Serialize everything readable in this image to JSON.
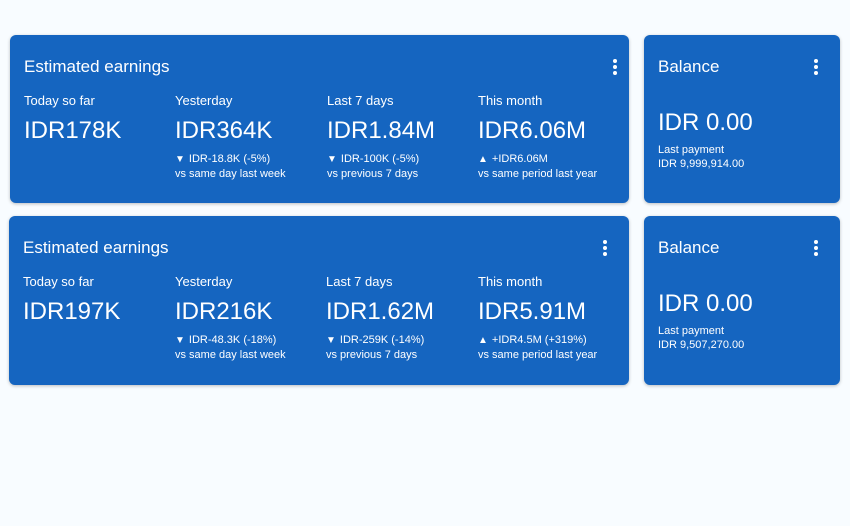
{
  "earnings_cards": [
    {
      "title": "Estimated earnings",
      "metrics": [
        {
          "label": "Today so far",
          "value": "IDR178K",
          "change": "",
          "compare": ""
        },
        {
          "label": "Yesterday",
          "value": "IDR364K",
          "arrow": "▼",
          "change": "IDR-18.8K (-5%)",
          "compare": "vs same day last week"
        },
        {
          "label": "Last 7 days",
          "value": "IDR1.84M",
          "arrow": "▼",
          "change": "IDR-100K (-5%)",
          "compare": "vs previous 7 days"
        },
        {
          "label": "This month",
          "value": "IDR6.06M",
          "arrow": "▲",
          "change": "+IDR6.06M",
          "compare": "vs same period last year"
        }
      ]
    },
    {
      "title": "Estimated earnings",
      "metrics": [
        {
          "label": "Today so far",
          "value": "IDR197K",
          "change": "",
          "compare": ""
        },
        {
          "label": "Yesterday",
          "value": "IDR216K",
          "arrow": "▼",
          "change": "IDR-48.3K (-18%)",
          "compare": "vs same day last week"
        },
        {
          "label": "Last 7 days",
          "value": "IDR1.62M",
          "arrow": "▼",
          "change": "IDR-259K (-14%)",
          "compare": "vs previous 7 days"
        },
        {
          "label": "This month",
          "value": "IDR5.91M",
          "arrow": "▲",
          "change": "+IDR4.5M (+319%)",
          "compare": "vs same period last year"
        }
      ]
    }
  ],
  "balance_cards": [
    {
      "title": "Balance",
      "value": "IDR 0.00",
      "last_payment_label": "Last payment",
      "last_payment_value": "IDR 9,999,914.00"
    },
    {
      "title": "Balance",
      "value": "IDR 0.00",
      "last_payment_label": "Last payment",
      "last_payment_value": "IDR 9,507,270.00"
    }
  ],
  "colors": {
    "card_background": "#1565c0",
    "page_background": "#f8fcff",
    "text": "#ffffff"
  },
  "icons": {
    "more_menu": "more-vert-icon"
  }
}
